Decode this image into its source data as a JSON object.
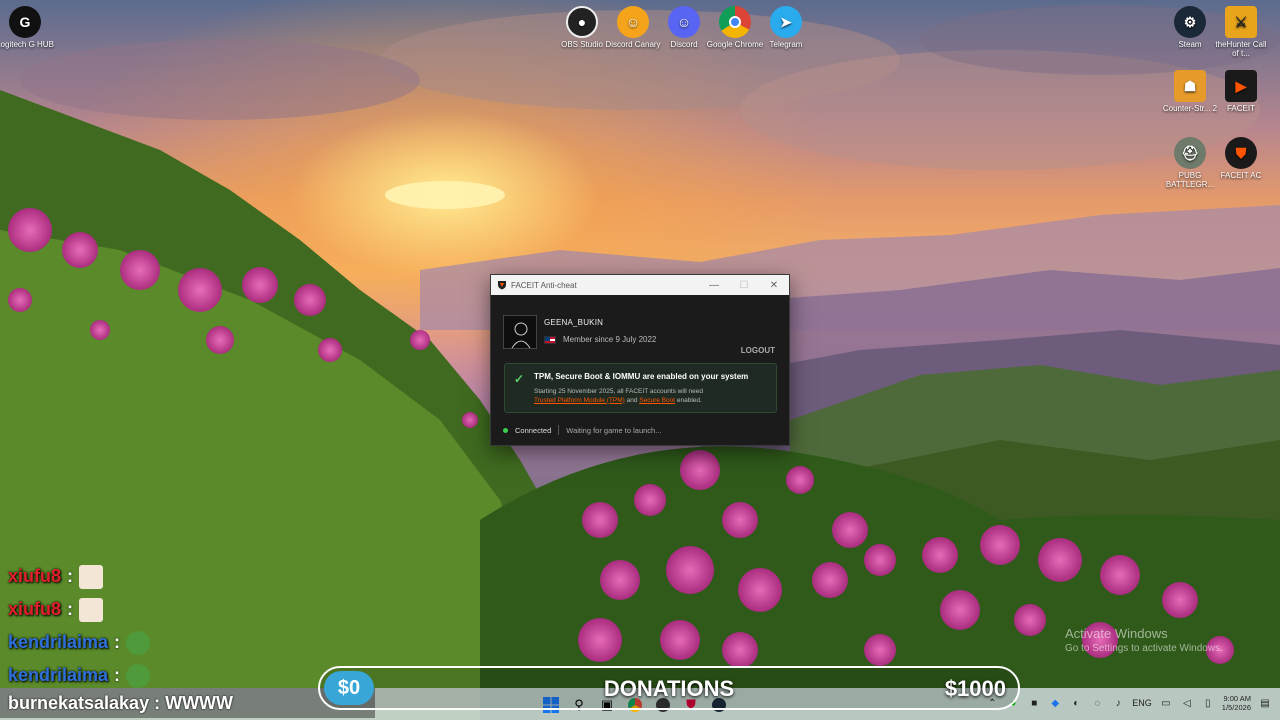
{
  "desktop": {
    "icons": [
      {
        "label": "Logitech G HUB",
        "icon": "logitech-g-icon"
      },
      {
        "label": "OBS Studio",
        "icon": "obs-icon"
      },
      {
        "label": "Discord Canary",
        "icon": "discord-canary-icon"
      },
      {
        "label": "Discord",
        "icon": "discord-icon"
      },
      {
        "label": "Google Chrome",
        "icon": "chrome-icon"
      },
      {
        "label": "Telegram",
        "icon": "telegram-icon"
      },
      {
        "label": "Steam",
        "icon": "steam-icon"
      },
      {
        "label": "theHunter Call of t...",
        "icon": "thehunter-icon"
      },
      {
        "label": "Counter-Str... 2",
        "icon": "cs2-icon"
      },
      {
        "label": "FACEIT",
        "icon": "faceit-icon"
      },
      {
        "label": "PUBG BATTLEGR...",
        "icon": "pubg-icon"
      },
      {
        "label": "FACEIT AC",
        "icon": "faceit-ac-icon"
      }
    ]
  },
  "faceit_window": {
    "title": "FACEIT Anti-cheat",
    "controls": {
      "minimize": "—",
      "maximize": "☐",
      "close": "✕"
    },
    "username": "GEENA_BUKIN",
    "member_since": "Member since 9 July 2022",
    "logout": "LOGOUT",
    "alert": {
      "title": "TPM, Secure Boot & IOMMU are enabled on your system",
      "body_start": "Starting 25 November 2025, all FACEIT accounts will need",
      "link_tpm": "Trusted Platform Module (TPM)",
      "and": "and",
      "link_secure_boot": "Secure Boot",
      "body_end": "enabled."
    },
    "status": "Connected",
    "waiting": "Waiting for game to launch..."
  },
  "chat": [
    {
      "user": "xiufu8",
      "color": "#e0202a",
      "colon": ":"
    },
    {
      "user": "xiufu8",
      "color": "#e0202a",
      "colon": ":"
    },
    {
      "user": "kendrilaima",
      "color": "#2f6fd8",
      "colon": ":"
    },
    {
      "user": "kendrilaima",
      "color": "#2f6fd8",
      "colon": ":"
    }
  ],
  "chat_last": "burnekatsalakay : WWWW",
  "donations": {
    "current": "$0",
    "label": "DONATIONS",
    "goal": "$1000"
  },
  "activate_windows": {
    "line1": "Activate Windows",
    "line2": "Go to Settings to activate Windows."
  },
  "taskbar": {
    "tray_lang": "ENG",
    "time": "9:00 AM",
    "date": "1/5/2026"
  }
}
